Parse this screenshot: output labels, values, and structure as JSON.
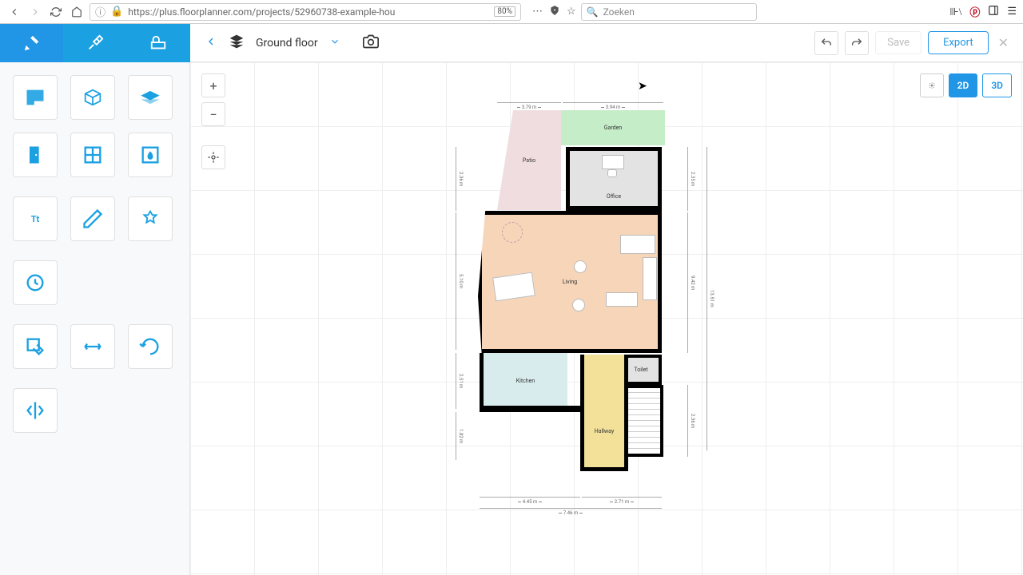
{
  "browser": {
    "url": "https://plus.floorplanner.com/projects/52960738-example-hou",
    "zoom": "80%",
    "search_placeholder": "Zoeken"
  },
  "header": {
    "floor_label": "Ground floor",
    "save_label": "Save",
    "export_label": "Export",
    "view_2d": "2D",
    "view_3d": "3D"
  },
  "rooms": {
    "garden": "Garden",
    "patio": "Patio",
    "office": "Office",
    "living": "Living",
    "kitchen": "Kitchen",
    "toilet": "Toilet",
    "hallway": "Hallway"
  },
  "dimensions": {
    "top_left": "3.79 m",
    "top_right": "3.94 m",
    "left_upper": "2.36 m",
    "left_mid": "5.10 m",
    "left_lower": "2.51 m",
    "left_bottom": "1.82 m",
    "right_upper": "2.35 m",
    "right_mid": "9.42 m",
    "right_total": "13.51 m",
    "right_lower": "2.36 m",
    "bottom_left": "4.45 m",
    "bottom_right": "2.71 m",
    "bottom_total": "7.46 m"
  },
  "tool_text_label": "Tt"
}
